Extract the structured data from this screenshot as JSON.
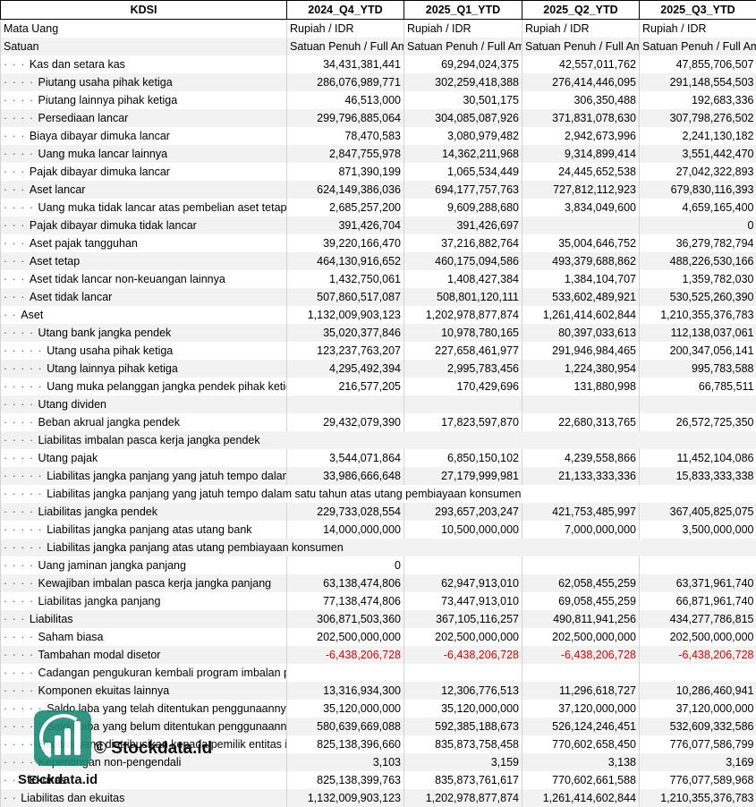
{
  "header": [
    "KDSI",
    "2024_Q4_YTD",
    "2025_Q1_YTD",
    "2025_Q2_YTD",
    "2025_Q3_YTD"
  ],
  "rows": [
    {
      "indent": "",
      "label": "Mata Uang",
      "v": [
        "Rupiah / IDR",
        "Rupiah / IDR",
        "Rupiah / IDR",
        "Rupiah / IDR"
      ],
      "align": "left"
    },
    {
      "indent": "",
      "label": "Satuan",
      "v": [
        "Satuan Penuh / Full Amount",
        "Satuan Penuh / Full Amount",
        "Satuan Penuh / Full Amount",
        "Satuan Penuh / Full Amount"
      ],
      "align": "left"
    },
    {
      "indent": "· · · ",
      "label": "Kas dan setara kas",
      "v": [
        "34,431,381,441",
        "69,294,024,375",
        "42,557,011,762",
        "47,855,706,507"
      ]
    },
    {
      "indent": "· · · · ",
      "label": "Piutang usaha pihak ketiga",
      "v": [
        "286,076,989,771",
        "302,259,418,388",
        "276,414,446,095",
        "291,148,554,503"
      ]
    },
    {
      "indent": "· · · · ",
      "label": "Piutang lainnya pihak ketiga",
      "v": [
        "46,513,000",
        "30,501,175",
        "306,350,488",
        "192,683,336"
      ]
    },
    {
      "indent": "· · · · ",
      "label": "Persediaan lancar",
      "v": [
        "299,796,885,064",
        "304,085,087,926",
        "371,831,078,630",
        "307,798,276,502"
      ]
    },
    {
      "indent": "· · · ",
      "label": "Biaya dibayar dimuka lancar",
      "v": [
        "78,470,583",
        "3,080,979,482",
        "2,942,673,996",
        "2,241,130,182"
      ]
    },
    {
      "indent": "· · · · ",
      "label": "Uang muka lancar lainnya",
      "v": [
        "2,847,755,978",
        "14,362,211,968",
        "9,314,899,414",
        "3,551,442,470"
      ]
    },
    {
      "indent": "· · · ",
      "label": "Pajak dibayar dimuka lancar",
      "v": [
        "871,390,199",
        "1,065,534,449",
        "24,445,652,538",
        "27,042,322,893"
      ]
    },
    {
      "indent": "· · · ",
      "label": "Aset lancar",
      "v": [
        "624,149,386,036",
        "694,177,757,763",
        "727,812,112,923",
        "679,830,116,393"
      ]
    },
    {
      "indent": "· · · · ",
      "label": "Uang muka tidak lancar atas pembelian aset tetap",
      "v": [
        "2,685,257,200",
        "9,609,288,680",
        "3,834,049,600",
        "4,659,165,400"
      ]
    },
    {
      "indent": "· · · ",
      "label": "Pajak dibayar dimuka tidak lancar",
      "v": [
        "391,426,704",
        "391,426,697",
        "",
        "0"
      ]
    },
    {
      "indent": "· · · ",
      "label": "Aset pajak tangguhan",
      "v": [
        "39,220,166,470",
        "37,216,882,764",
        "35,004,646,752",
        "36,279,782,794"
      ]
    },
    {
      "indent": "· · · ",
      "label": "Aset tetap",
      "v": [
        "464,130,916,652",
        "460,175,094,586",
        "493,379,688,862",
        "488,226,530,166"
      ]
    },
    {
      "indent": "· · · ",
      "label": "Aset tidak lancar non-keuangan lainnya",
      "v": [
        "1,432,750,061",
        "1,408,427,384",
        "1,384,104,707",
        "1,359,782,030"
      ]
    },
    {
      "indent": "· · · ",
      "label": "Aset tidak lancar",
      "v": [
        "507,860,517,087",
        "508,801,120,111",
        "533,602,489,921",
        "530,525,260,390"
      ]
    },
    {
      "indent": "· · ",
      "label": "Aset",
      "v": [
        "1,132,009,903,123",
        "1,202,978,877,874",
        "1,261,414,602,844",
        "1,210,355,376,783"
      ]
    },
    {
      "indent": "· · · · ",
      "label": "Utang bank jangka pendek",
      "v": [
        "35,020,377,846",
        "10,978,780,165",
        "80,397,033,613",
        "112,138,037,061"
      ]
    },
    {
      "indent": "· · · · · ",
      "label": "Utang usaha pihak ketiga",
      "v": [
        "123,237,763,207",
        "227,658,461,977",
        "291,946,984,465",
        "200,347,056,141"
      ]
    },
    {
      "indent": "· · · · · ",
      "label": "Utang lainnya pihak ketiga",
      "v": [
        "4,295,492,394",
        "2,995,783,456",
        "1,224,380,954",
        "995,783,588"
      ]
    },
    {
      "indent": "· · · · · ",
      "label": "Uang muka pelanggan jangka pendek pihak ketiga",
      "v": [
        "216,577,205",
        "170,429,696",
        "131,880,998",
        "66,785,511"
      ]
    },
    {
      "indent": "· · · · ",
      "label": "Utang dividen",
      "v": [
        "",
        "",
        "",
        ""
      ]
    },
    {
      "indent": "· · · · ",
      "label": "Beban akrual jangka pendek",
      "v": [
        "29,432,079,390",
        "17,823,597,870",
        "22,680,313,765",
        "26,572,725,350"
      ]
    },
    {
      "indent": "· · · · ",
      "label": "Liabilitas imbalan pasca kerja jangka pendek",
      "v": [
        "",
        "",
        "",
        ""
      ],
      "span": true
    },
    {
      "indent": "· · · · ",
      "label": "Utang pajak",
      "v": [
        "3,544,071,864",
        "6,850,150,102",
        "4,239,558,866",
        "11,452,104,086"
      ]
    },
    {
      "indent": "· · · · · ",
      "label": "Liabilitas jangka panjang yang jatuh tempo dalam satu tahun atas utang bank",
      "v": [
        "33,986,666,648",
        "27,179,999,981",
        "21,133,333,336",
        "15,833,333,338"
      ]
    },
    {
      "indent": "· · · · · ",
      "label": "Liabilitas jangka panjang yang jatuh tempo dalam satu tahun atas utang pembiayaan konsumen",
      "v": [
        "",
        "",
        "",
        ""
      ],
      "span": true
    },
    {
      "indent": "· · · · ",
      "label": "Liabilitas jangka pendek",
      "v": [
        "229,733,028,554",
        "293,657,203,247",
        "421,753,485,997",
        "367,405,825,075"
      ]
    },
    {
      "indent": "· · · · · ",
      "label": "Liabilitas jangka panjang atas utang bank",
      "v": [
        "14,000,000,000",
        "10,500,000,000",
        "7,000,000,000",
        "3,500,000,000"
      ]
    },
    {
      "indent": "· · · · · ",
      "label": "Liabilitas jangka panjang atas utang pembiayaan konsumen",
      "v": [
        "",
        "",
        "",
        ""
      ],
      "span": true
    },
    {
      "indent": "· · · · ",
      "label": "Uang jaminan jangka panjang",
      "v": [
        "0",
        "",
        "",
        ""
      ]
    },
    {
      "indent": "· · · · ",
      "label": "Kewajiban imbalan pasca kerja jangka panjang",
      "v": [
        "63,138,474,806",
        "62,947,913,010",
        "62,058,455,259",
        "63,371,961,740"
      ]
    },
    {
      "indent": "· · · · ",
      "label": "Liabilitas jangka panjang",
      "v": [
        "77,138,474,806",
        "73,447,913,010",
        "69,058,455,259",
        "66,871,961,740"
      ]
    },
    {
      "indent": "· · · ",
      "label": "Liabilitas",
      "v": [
        "306,871,503,360",
        "367,105,116,257",
        "490,811,941,256",
        "434,277,786,815"
      ]
    },
    {
      "indent": "· · · · ",
      "label": "Saham biasa",
      "v": [
        "202,500,000,000",
        "202,500,000,000",
        "202,500,000,000",
        "202,500,000,000"
      ]
    },
    {
      "indent": "· · · · ",
      "label": "Tambahan modal disetor",
      "v": [
        "-6,438,206,728",
        "-6,438,206,728",
        "-6,438,206,728",
        "-6,438,206,728"
      ],
      "neg": true
    },
    {
      "indent": "· · · · ",
      "label": "Cadangan pengukuran kembali program imbalan pasti",
      "v": [
        "",
        "",
        "",
        ""
      ]
    },
    {
      "indent": "· · · · ",
      "label": "Komponen ekuitas lainnya",
      "v": [
        "13,316,934,300",
        "12,306,776,513",
        "11,296,618,727",
        "10,286,460,941"
      ]
    },
    {
      "indent": "· · · · · ",
      "label": "Saldo laba yang telah ditentukan penggunaannya",
      "v": [
        "35,120,000,000",
        "35,120,000,000",
        "37,120,000,000",
        "37,120,000,000"
      ]
    },
    {
      "indent": "· · · · · ",
      "label": "Saldo laba yang belum ditentukan penggunaannya",
      "v": [
        "580,639,669,088",
        "592,385,188,673",
        "526,124,246,451",
        "532,609,332,586"
      ]
    },
    {
      "indent": "· · · · ",
      "label": "Ekuitas yang diatribusikan kepada pemilik entitas induk",
      "v": [
        "825,138,396,660",
        "835,873,758,458",
        "770,602,658,450",
        "776,077,586,799"
      ]
    },
    {
      "indent": "· · · · ",
      "label": "Kepentingan non-pengendali",
      "v": [
        "3,103",
        "3,159",
        "3,138",
        "3,169"
      ]
    },
    {
      "indent": "· · · ",
      "label": "Ekuitas",
      "v": [
        "825,138,399,763",
        "835,873,761,617",
        "770,602,661,588",
        "776,077,589,968"
      ]
    },
    {
      "indent": "· · ",
      "label": "Liabilitas dan ekuitas",
      "v": [
        "1,132,009,903,123",
        "1,202,978,877,874",
        "1,261,414,602,844",
        "1,210,355,376,783"
      ]
    }
  ],
  "watermark": {
    "brand": "© Stockdata.id",
    "site": "Stockdata.id",
    "logo_color": "#1a8a74"
  }
}
